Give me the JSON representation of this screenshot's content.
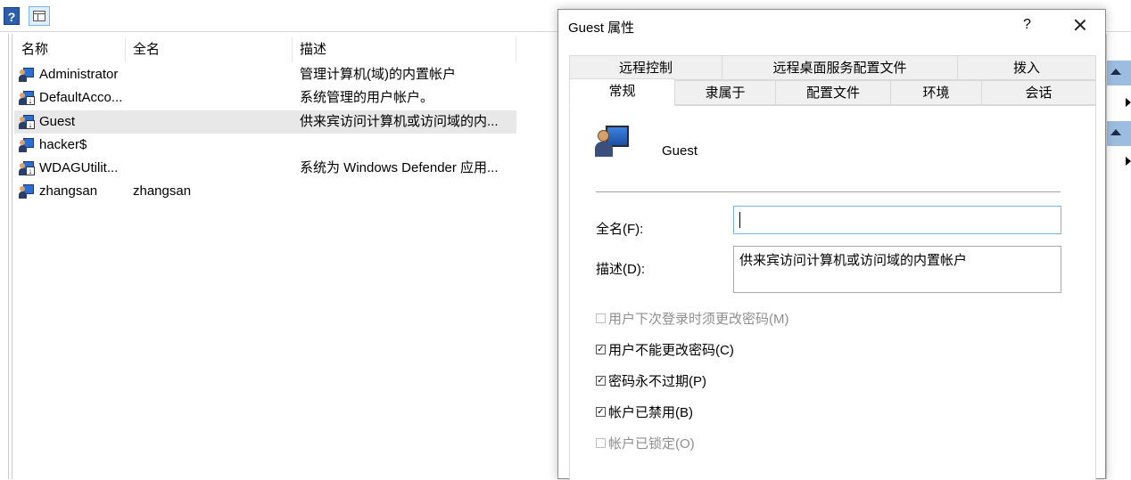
{
  "toolbar": {
    "help_icon": "help-icon",
    "view_icon": "show-hide-pane-icon",
    "help_label": "?"
  },
  "list": {
    "columns": [
      "名称",
      "全名",
      "描述"
    ],
    "rows": [
      {
        "name": "Administrator",
        "fullname": "",
        "description": "管理计算机(域)的内置帐户",
        "icon": "user-icon"
      },
      {
        "name": "DefaultAcco...",
        "fullname": "",
        "description": "系统管理的用户帐户。",
        "icon": "user-disabled-icon"
      },
      {
        "name": "Guest",
        "fullname": "",
        "description": "供来宾访问计算机或访问域的内...",
        "icon": "user-disabled-icon",
        "selected": true
      },
      {
        "name": "hacker$",
        "fullname": "",
        "description": "",
        "icon": "user-icon"
      },
      {
        "name": "WDAGUtilit...",
        "fullname": "",
        "description": "系统为 Windows Defender 应用...",
        "icon": "user-disabled-icon"
      },
      {
        "name": "zhangsan",
        "fullname": "zhangsan",
        "description": "",
        "icon": "user-icon"
      }
    ]
  },
  "dialog": {
    "title": "Guest 属性",
    "help": "?",
    "tabs_row1": [
      "远程控制",
      "远程桌面服务配置文件",
      "拨入"
    ],
    "tabs_row2": [
      "常规",
      "隶属于",
      "配置文件",
      "环境",
      "会话"
    ],
    "active_tab": "常规",
    "username": "Guest",
    "fullname_label": "全名(F):",
    "fullname_value": "",
    "description_label": "描述(D):",
    "description_value": "供来宾访问计算机或访问域的内置帐户",
    "checkboxes": [
      {
        "label": "用户下次登录时须更改密码(M)",
        "checked": false,
        "disabled": true
      },
      {
        "label": "用户不能更改密码(C)",
        "checked": true,
        "disabled": false
      },
      {
        "label": "密码永不过期(P)",
        "checked": true,
        "disabled": false
      },
      {
        "label": "帐户已禁用(B)",
        "checked": true,
        "disabled": false
      },
      {
        "label": "帐户已锁定(O)",
        "checked": false,
        "disabled": true
      }
    ]
  }
}
